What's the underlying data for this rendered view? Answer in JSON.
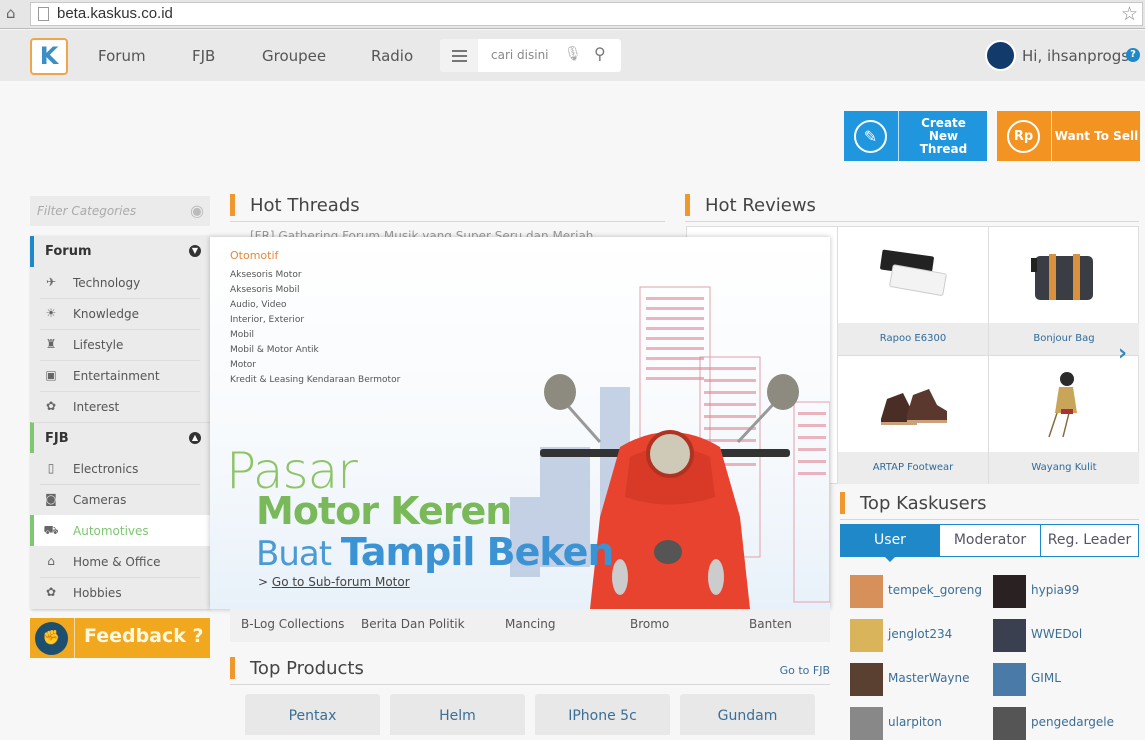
{
  "browser": {
    "url": "beta.kaskus.co.id"
  },
  "nav": {
    "logo": "K",
    "links": [
      "Forum",
      "FJB",
      "Groupee",
      "Radio"
    ],
    "search_placeholder": "cari disini",
    "greeting": "Hi, ihsanprogs",
    "help": "?"
  },
  "actions": {
    "create_thread": "Create New Thread",
    "create_icon": "✎",
    "want_to_sell": "Want To Sell",
    "sell_icon": "Rp"
  },
  "sidebar": {
    "filter_placeholder": "Filter Categories",
    "groups": [
      {
        "title": "Forum",
        "items": [
          {
            "label": "Technology",
            "icon": "rocket-icon",
            "glyph": "✈"
          },
          {
            "label": "Knowledge",
            "icon": "lightbulb-icon",
            "glyph": "☀"
          },
          {
            "label": "Lifestyle",
            "icon": "hat-icon",
            "glyph": "♜"
          },
          {
            "label": "Entertainment",
            "icon": "tv-icon",
            "glyph": "▣"
          },
          {
            "label": "Interest",
            "icon": "palette-icon",
            "glyph": "✿"
          }
        ]
      },
      {
        "title": "FJB",
        "items": [
          {
            "label": "Electronics",
            "icon": "phone-icon",
            "glyph": "▯"
          },
          {
            "label": "Cameras",
            "icon": "camera-icon",
            "glyph": "◙"
          },
          {
            "label": "Automotives",
            "icon": "car-icon",
            "glyph": "⛟",
            "active": true
          },
          {
            "label": "Home & Office",
            "icon": "home-icon",
            "glyph": "⌂"
          },
          {
            "label": "Hobbies",
            "icon": "palette-icon",
            "glyph": "✿"
          }
        ]
      }
    ],
    "feedback": "Feedback ?"
  },
  "hot_threads": {
    "title": "Hot Threads",
    "peek": "[FR] Gathering Forum Musik yang Super Seru dan Meriah"
  },
  "mega_menu": {
    "category": "Otomotif",
    "subcategories": [
      "Aksesoris Motor",
      "Aksesoris Mobil",
      "Audio, Video",
      "Interior, Exterior",
      "Mobil",
      "Mobil & Motor Antik",
      "Motor",
      "Kredit & Leasing Kendaraan Bermotor"
    ],
    "promo_line1": "Pasar",
    "promo_line2": "Motor Keren",
    "promo_line3a": "Buat",
    "promo_line3b": "Tampil Beken",
    "promo_link_prefix": ">",
    "promo_link": "Go to Sub-forum Motor"
  },
  "tags": [
    "B-Log Collections",
    "Berita Dan Politik",
    "Mancing",
    "Bromo",
    "Banten"
  ],
  "top_products": {
    "title": "Top Products",
    "link": "Go to FJB",
    "items": [
      "Pentax",
      "Helm",
      "IPhone 5c",
      "Gundam"
    ]
  },
  "hot_reviews": {
    "title": "Hot Reviews",
    "items": [
      "Rapoo E6300",
      "Bonjour Bag",
      "ARTAP Footwear",
      "Wayang Kulit"
    ]
  },
  "top_kaskusers": {
    "title": "Top Kaskusers",
    "tabs": [
      "User",
      "Moderator",
      "Reg. Leader"
    ],
    "active_tab": "User",
    "users": [
      "tempek_goreng",
      "hypia99",
      "jenglot234",
      "WWEDol",
      "MasterWayne",
      "GIML",
      "ularpiton",
      "pengedargele"
    ]
  },
  "colors": {
    "primary_blue": "#1e88c8",
    "orange": "#f39321",
    "green": "#7cc76f",
    "feedback": "#f1a81e"
  }
}
